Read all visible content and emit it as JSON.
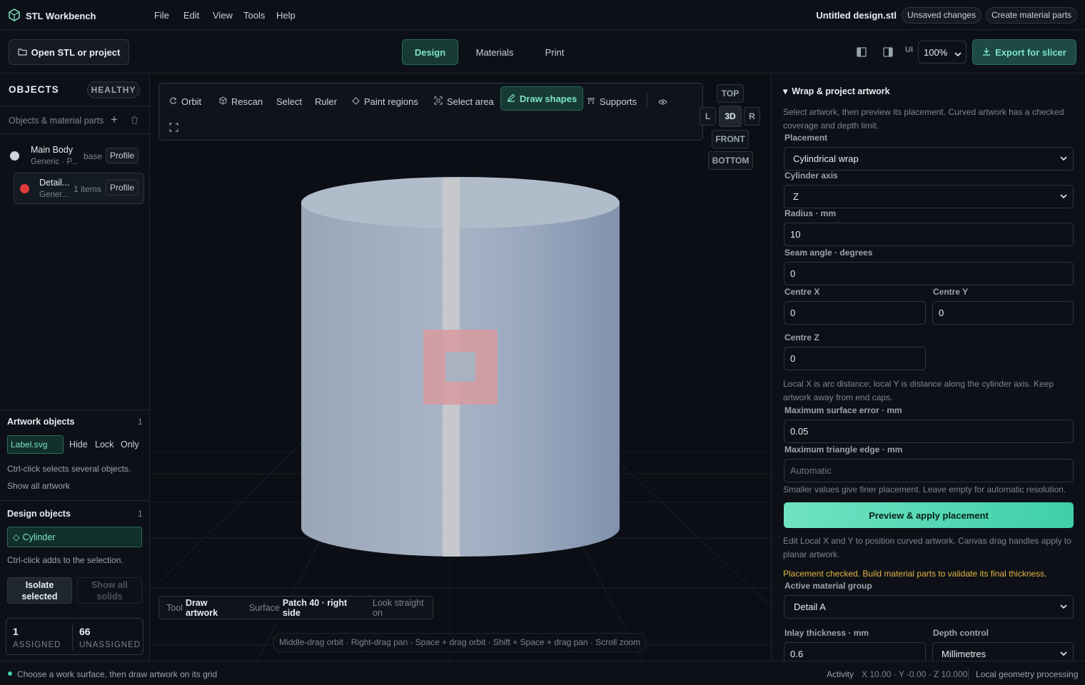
{
  "app": {
    "name": "STL Workbench",
    "filename": "Untitled design.stl",
    "unsaved": "Unsaved changes",
    "create_parts": "Create material parts"
  },
  "menu": [
    "File",
    "Edit",
    "View",
    "Tools",
    "Help"
  ],
  "toolbar": {
    "open": "Open STL or project",
    "tabs": [
      "Design",
      "Materials",
      "Print"
    ],
    "ui_label": "UI",
    "zoom": "100%",
    "export": "Export for slicer"
  },
  "objects": {
    "title": "OBJECTS",
    "health": "HEALTHY",
    "subtitle": "Objects & material parts",
    "items": [
      {
        "name": "Main Body",
        "sub": "Generic · P...",
        "tag": "base",
        "profile": "Profile",
        "color": "#d0d4da"
      },
      {
        "name": "Detail...",
        "sub": "Gener...",
        "tag": "1 items",
        "profile": "Profile",
        "color": "#e03a3a"
      }
    ]
  },
  "artwork": {
    "title": "Artwork objects",
    "count": "1",
    "chip": "Label.svg",
    "hide": "Hide",
    "lock": "Lock",
    "only": "Only",
    "hint": "Ctrl-click selects several objects.",
    "show_all": "Show all artwork"
  },
  "design": {
    "title": "Design objects",
    "count": "1",
    "chip": "Cylinder",
    "hint": "Ctrl-click adds to the selection.",
    "isolate": "Isolate selected",
    "show_solids": "Show all solids",
    "assigned_n": "1",
    "assigned": "ASSIGNED",
    "unassigned_n": "66",
    "unassigned": "UNASSIGNED"
  },
  "viewport": {
    "tools": [
      "Orbit",
      "Rescan",
      "Select",
      "Ruler",
      "Paint regions",
      "Select area",
      "Draw shapes",
      "Supports"
    ],
    "views": {
      "top": "TOP",
      "l": "L",
      "d3": "3D",
      "r": "R",
      "front": "FRONT",
      "bottom": "BOTTOM"
    },
    "info": {
      "tool_label": "Tool",
      "tool": "Draw artwork",
      "surface_label": "Surface",
      "surface": "Patch 40 · right side",
      "look": "Look straight on"
    },
    "hint": "Middle-drag orbit · Right-drag pan · Space + drag orbit · Shift + Space + drag pan · Scroll zoom"
  },
  "wrap": {
    "title": "Wrap & project artwork",
    "desc": "Select artwork, then preview its placement. Curved artwork has a checked coverage and depth limit.",
    "placement_label": "Placement",
    "placement": "Cylindrical wrap",
    "axis_label": "Cylinder axis",
    "axis": "Z",
    "radius_label": "Radius · mm",
    "radius": "10",
    "seam_label": "Seam angle · degrees",
    "seam": "0",
    "cx_label": "Centre X",
    "cx": "0",
    "cy_label": "Centre Y",
    "cy": "0",
    "cz_label": "Centre Z",
    "cz": "0",
    "local_help": "Local X is arc distance; local Y is distance along the cylinder axis. Keep artwork away from end caps.",
    "err_label": "Maximum surface error · mm",
    "err": "0.05",
    "tri_label": "Maximum triangle edge · mm",
    "tri_placeholder": "Automatic",
    "tri_help": "Smaller values give finer placement. Leave empty for automatic resolution.",
    "apply": "Preview & apply placement",
    "edit_help": "Edit Local X and Y to position curved artwork. Canvas drag handles apply to planar artwork.",
    "warn": "Placement checked. Build material parts to validate its final thickness.",
    "group_label": "Active material group",
    "group": "Detail A",
    "inlay_label": "Inlay thickness · mm",
    "inlay": "0.6",
    "depth_label": "Depth control",
    "depth": "Millimetres"
  },
  "status": {
    "message": "Choose a work surface, then draw artwork on its grid",
    "activity": "Activity",
    "coords": "X 10.00 · Y -0.00 · Z 10.000",
    "mode": "Local geometry processing"
  },
  "colors": {
    "accent": "#7ee3c9",
    "accent_bg": "#173a35",
    "warn": "#e3b341"
  }
}
